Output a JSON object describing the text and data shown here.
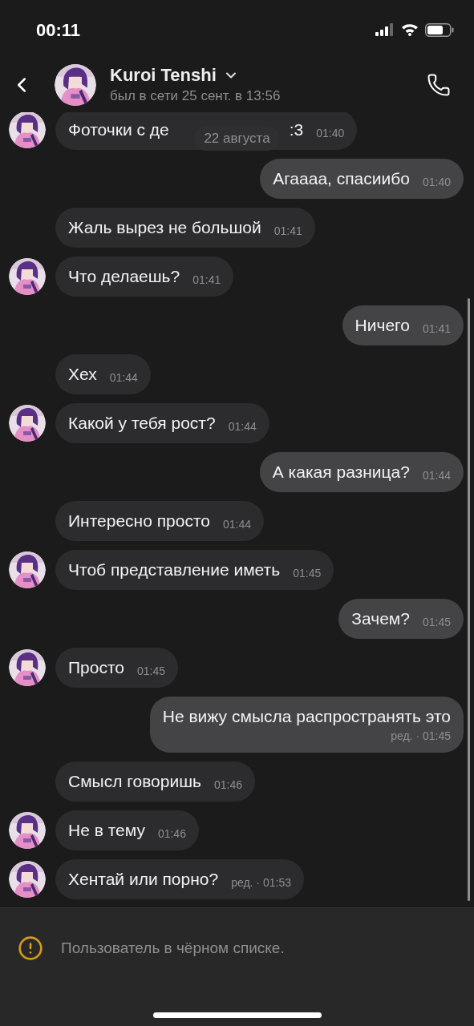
{
  "status_bar": {
    "time": "00:11"
  },
  "header": {
    "name": "Kuroi Tenshi",
    "last_seen": "был в сети 25 сент. в 13:56"
  },
  "date_pill": "22 августа",
  "messages": [
    {
      "kind": "incoming",
      "avatar": true,
      "text": "Фоточки с де",
      "tail": ":3",
      "time": "01:40"
    },
    {
      "kind": "outgoing",
      "text": "Агаааа, спасиибо",
      "time": "01:40"
    },
    {
      "kind": "incoming",
      "avatar": false,
      "text": "Жаль вырез не большой",
      "time": "01:41"
    },
    {
      "kind": "incoming",
      "avatar": true,
      "text": "Что делаешь?",
      "time": "01:41"
    },
    {
      "kind": "outgoing",
      "text": "Ничего",
      "time": "01:41"
    },
    {
      "kind": "incoming",
      "avatar": false,
      "text": "Хех",
      "time": "01:44"
    },
    {
      "kind": "incoming",
      "avatar": true,
      "text": "Какой у тебя рост?",
      "time": "01:44"
    },
    {
      "kind": "outgoing",
      "text": "А какая разница?",
      "time": "01:44"
    },
    {
      "kind": "incoming",
      "avatar": false,
      "text": "Интересно просто",
      "time": "01:44"
    },
    {
      "kind": "incoming",
      "avatar": true,
      "text": "Чтоб представление иметь",
      "time": "01:45"
    },
    {
      "kind": "outgoing",
      "text": "Зачем?",
      "time": "01:45"
    },
    {
      "kind": "incoming",
      "avatar": true,
      "text": "Просто",
      "time": "01:45"
    },
    {
      "kind": "outgoing",
      "text": "Не вижу смысла распространять это",
      "time": "ред. · 01:45"
    },
    {
      "kind": "incoming",
      "avatar": false,
      "text": "Смысл говоришь",
      "time": "01:46"
    },
    {
      "kind": "incoming",
      "avatar": true,
      "text": "Не в тему",
      "time": "01:46"
    },
    {
      "kind": "incoming",
      "avatar": true,
      "text": "Хентай или порно?",
      "time": "ред. · 01:53"
    }
  ],
  "blocked_notice": "Пользователь в чёрном списке."
}
